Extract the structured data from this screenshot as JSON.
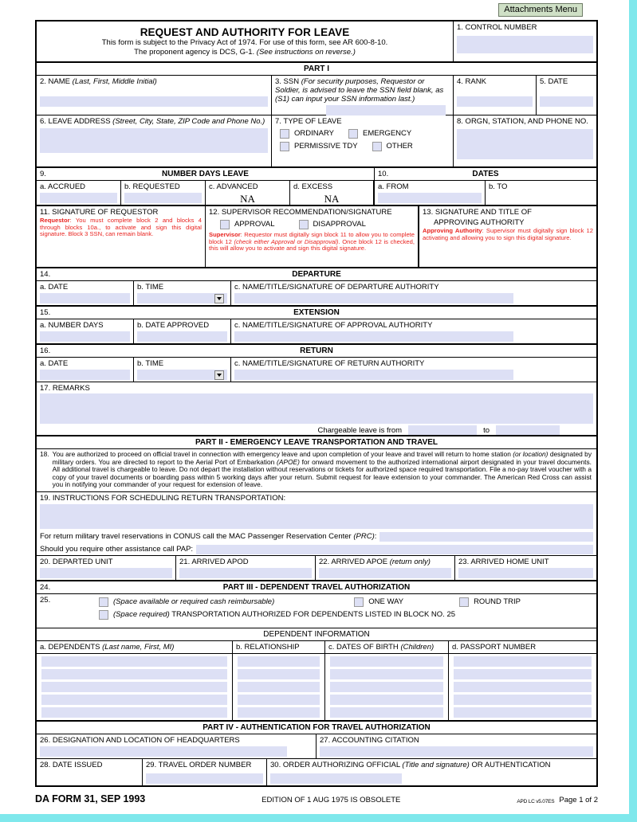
{
  "toolbar": {
    "attachments_menu": "Attachments Menu"
  },
  "header": {
    "title": "REQUEST AND AUTHORITY FOR LEAVE",
    "sub1": "This form is subject to the Privacy Act of 1974. For use of this form, see AR 600-8-10.",
    "sub2_plain": "The proponent agency is DCS, G-1. ",
    "sub2_ital": "(See instructions on reverse.)",
    "control_number_label": "1. CONTROL NUMBER"
  },
  "part1": {
    "bar": "PART I",
    "name_label": "2.  NAME",
    "name_hint": "(Last, First, Middle Initial)",
    "ssn_label": "3.  SSN",
    "ssn_hint": "(For security purposes, Requestor or Soldier, is advised to leave the SSN field blank, as (S1) can input your SSN information last.)",
    "rank_label": "4.  RANK",
    "date_label": "5.  DATE",
    "leave_address_label": "6.  LEAVE ADDRESS",
    "leave_address_hint": "(Street, City, State, ZIP Code and Phone No.)",
    "type_of_leave_label": "7.  TYPE OF LEAVE",
    "leave_types": [
      "ORDINARY",
      "EMERGENCY",
      "PERMISSIVE TDY",
      "OTHER"
    ],
    "orgn_label": "8.  ORGN, STATION, AND PHONE NO."
  },
  "days": {
    "num9": "9.",
    "title": "NUMBER DAYS LEAVE",
    "accrued": "a.  ACCRUED",
    "requested": "b.  REQUESTED",
    "advanced": "c.  ADVANCED",
    "excess": "d.  EXCESS",
    "advanced_value": "NA",
    "excess_value": "NA",
    "num10": "10.",
    "dates_title": "DATES",
    "from": "a.  FROM",
    "to": "b.  TO"
  },
  "signatures": {
    "b11_label": "11.  SIGNATURE OF REQUESTOR",
    "b11_red_bold": "Requestor",
    "b11_red_text": ": You must complete block 2 and blocks 4 through blocks 10a., to activate and sign this digital signature. Block 3 SSN, can remain blank.",
    "b12_label": "12.  SUPERVISOR RECOMMENDATION/SIGNATURE",
    "b12_approval": "APPROVAL",
    "b12_disapproval": "DISAPPROVAL",
    "b12_red_bold": "Supervisor",
    "b12_red_1": ": Requestor must digitally sign block 11 to allow you to complete block 12 ",
    "b12_red_ital": "(check either Approval or Disapproval)",
    "b12_red_2": ". Once block 12 is checked, this will allow you to activate and sign this digital signature.",
    "b13_label_line1": "13.  SIGNATURE AND TITLE OF",
    "b13_label_line2": "APPROVING AUTHORITY",
    "b13_red_bold": "Approving Authority",
    "b13_red_text": ": Supervisor must digitally sign block 12 activating and allowing you to sign this digital signature."
  },
  "departure": {
    "num": "14.",
    "title": "DEPARTURE",
    "date": "a.  DATE",
    "time": "b.  TIME",
    "auth": "c.  NAME/TITLE/SIGNATURE OF DEPARTURE AUTHORITY"
  },
  "extension": {
    "num": "15.",
    "title": "EXTENSION",
    "number_days": "a.  NUMBER DAYS",
    "date_approved": "b.  DATE APPROVED",
    "auth": "c.  NAME/TITLE/SIGNATURE OF APPROVAL AUTHORITY"
  },
  "ret": {
    "num": "16.",
    "title": "RETURN",
    "date": "a.  DATE",
    "time": "b.  TIME",
    "auth": "c.  NAME/TITLE/SIGNATURE OF RETURN AUTHORITY"
  },
  "remarks": {
    "label": "17.  REMARKS",
    "chargeable_from": "Chargeable leave is from",
    "chargeable_to": "to"
  },
  "part2": {
    "bar": "PART II - EMERGENCY LEAVE TRANSPORTATION AND TRAVEL",
    "b18_num": "18.",
    "b18_p1": "You are authorized to proceed on official travel in connection with emergency leave and upon completion of your leave and travel will return to home station ",
    "b18_i1": "(or location)",
    "b18_p2": " designated by military orders. You are directed to report to the Aerial Port of Embarkation ",
    "b18_i2": "(APOE)",
    "b18_p3": " for onward movement to the authorized international airport designated in your travel documents. All additional travel is chargeable to leave. Do not depart the installation without reservations or tickets for authorized space required transportation. File a no-pay travel voucher with a copy of your travel documents or boarding pass within 5 working days after your return. Submit request for leave extension to your commander. The American Red Cross can assist you in notifying your commander of your request for extension of leave.",
    "b19_label": "19. INSTRUCTIONS FOR SCHEDULING RETURN TRANSPORTATION:",
    "conus_text": "For return military travel reservations in CONUS call the MAC Passenger Reservation Center ",
    "conus_ital": "(PRC)",
    "conus_colon": ":",
    "pap_text": "Should you require other assistance call PAP:",
    "b20": "20.  DEPARTED UNIT",
    "b21": "21.  ARRIVED APOD",
    "b22_label": "22.  ARRIVED APOE",
    "b22_ital": "(return only)",
    "b23": "23.  ARRIVED HOME UNIT"
  },
  "part3": {
    "num24": "24.",
    "bar": "PART III - DEPENDENT TRAVEL AUTHORIZATION",
    "num25": "25.",
    "opt_space_available": "(Space available or required cash reimbursable)",
    "one_way": "ONE WAY",
    "round_trip": "ROUND TRIP",
    "space_required_ital": "(Space required)",
    "space_required_rest": " TRANSPORTATION AUTHORIZED FOR DEPENDENTS LISTED IN BLOCK NO. 25",
    "dep_info_bar": "DEPENDENT INFORMATION",
    "col_a_label": "a.  DEPENDENTS",
    "col_a_hint": "(Last name, First, MI)",
    "col_b": "b.  RELATIONSHIP",
    "col_c_label": "c.  DATES OF BIRTH",
    "col_c_hint": "(Children)",
    "col_d": "d.  PASSPORT NUMBER",
    "row_count": 5
  },
  "part4": {
    "bar": "PART IV - AUTHENTICATION FOR TRAVEL AUTHORIZATION",
    "b26": "26.  DESIGNATION AND LOCATION OF HEADQUARTERS",
    "b27": "27.  ACCOUNTING CITATION",
    "b28": "28.  DATE ISSUED",
    "b29": "29.  TRAVEL ORDER NUMBER",
    "b30_p1": "30.  ORDER AUTHORIZING OFFICIAL ",
    "b30_ital": "(Title and signature)",
    "b30_p2": " OR AUTHENTICATION"
  },
  "footer": {
    "form_id": "DA FORM 31, SEP 1993",
    "edition": "EDITION OF 1 AUG 1975 IS OBSOLETE",
    "apd": "APD LC v5.07ES",
    "page": "Page 1 of 2"
  },
  "colors": {
    "field_blue": "#dde0f5",
    "red_instruction": "#e8231f",
    "attach_green": "#cfe0c6",
    "page_bg": "#7fe8ec"
  }
}
